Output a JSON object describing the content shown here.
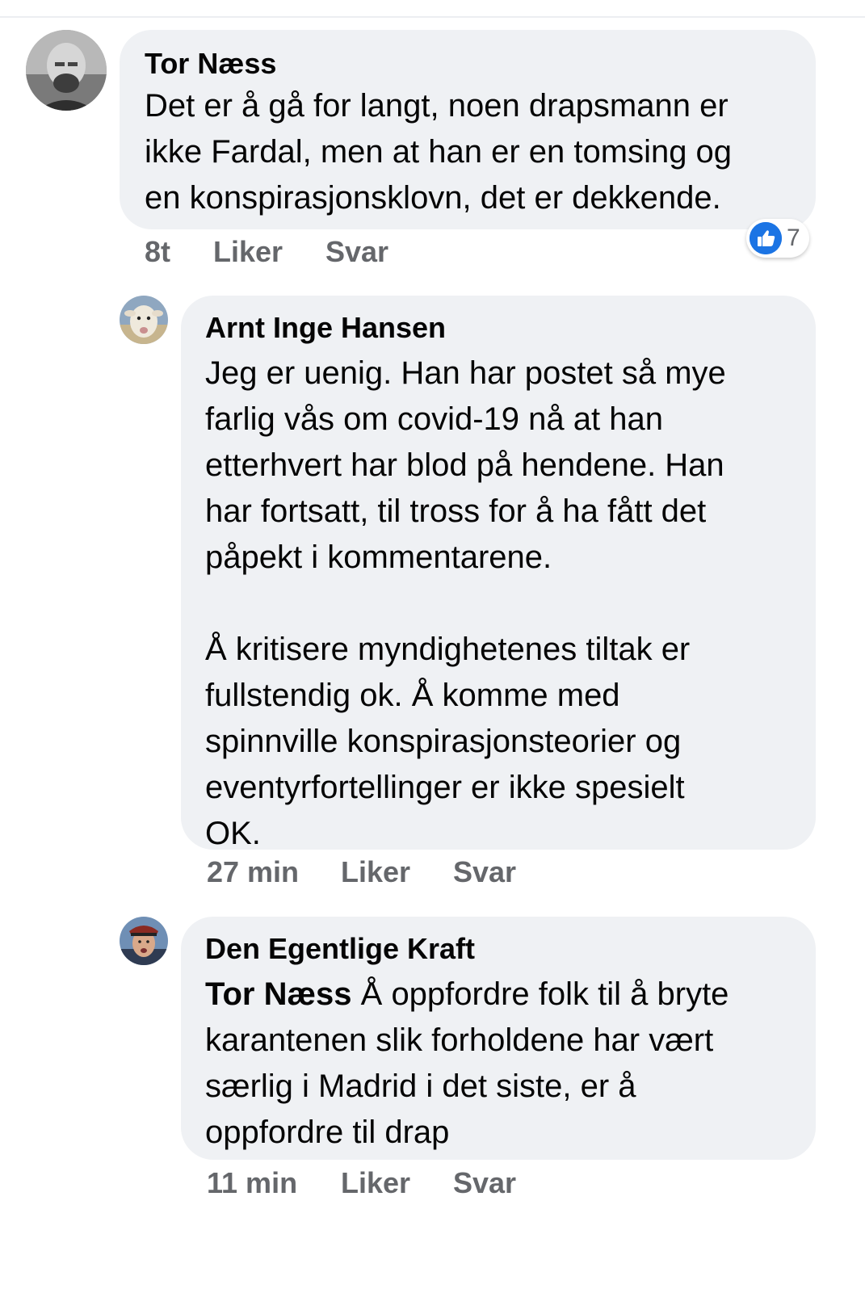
{
  "comments": [
    {
      "author": "Tor Næss",
      "lines": [
        "Det er å gå for langt, noen drapsmann er",
        "ikke Fardal, men at han er en tomsing og",
        "en konspirasjonsklovn, det er dekkende."
      ],
      "time": "8t",
      "like_label": "Liker",
      "reply_label": "Svar",
      "reaction": {
        "icon": "thumbs-up-icon",
        "count": "7",
        "color": "#1b74e4"
      }
    },
    {
      "author": "Arnt Inge Hansen",
      "lines": [
        "Jeg er uenig. Han har postet så mye",
        "farlig vås om covid-19 nå at han",
        "etterhvert har blod på hendene. Han",
        "har fortsatt, til tross for å ha fått det",
        "påpekt i kommentarene.",
        "",
        "Å kritisere myndighetenes tiltak er",
        "fullstendig ok. Å komme med",
        "spinnville konspirasjonsteorier og",
        "eventyrfortellinger er ikke spesielt",
        "OK."
      ],
      "time": "27 min",
      "like_label": "Liker",
      "reply_label": "Svar"
    },
    {
      "author": "Den Egentlige Kraft",
      "mention": "Tor Næss",
      "lines": [
        " Å oppfordre folk til å bryte",
        "karantenen slik forholdene har vært",
        "særlig i Madrid i det siste, er å",
        "oppfordre til drap"
      ],
      "time": "11 min",
      "like_label": "Liker",
      "reply_label": "Svar"
    }
  ],
  "colors": {
    "bubble": "#eff1f4",
    "secondary_text": "#65676b",
    "like_blue": "#1b74e4"
  }
}
